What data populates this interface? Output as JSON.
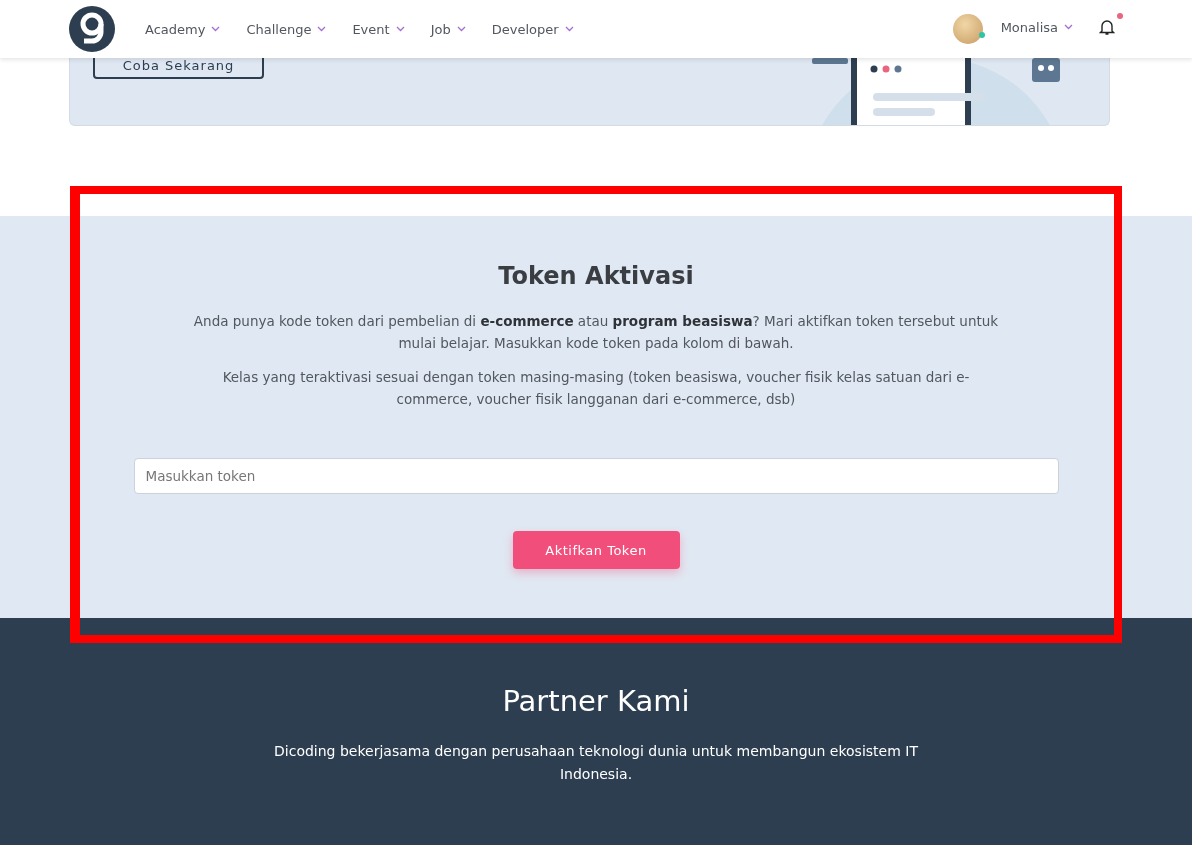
{
  "nav": {
    "items": [
      {
        "label": "Academy"
      },
      {
        "label": "Challenge"
      },
      {
        "label": "Event"
      },
      {
        "label": "Job"
      },
      {
        "label": "Developer"
      }
    ],
    "user": {
      "name": "Monalisa",
      "online": true
    },
    "notifications": {
      "unread": true
    }
  },
  "banner": {
    "button": "Coba Sekarang"
  },
  "token": {
    "title": "Token Aktivasi",
    "paragraphs": [
      "Anda punya kode token dari pembelian di **e-commerce** atau **program beasiswa**? Mari aktifkan token tersebut untuk mulai belajar. Masukkan kode token pada kolom di bawah.",
      "Kelas yang teraktivasi sesuai dengan token masing-masing (token beasiswa, voucher fisik kelas satuan dari e-commerce, voucher fisik langganan dari e-commerce, dsb)"
    ],
    "input": {
      "placeholder": "Masukkan token"
    },
    "button": "Aktifkan Token"
  },
  "partners": {
    "title": "Partner Kami",
    "text": "Dicoding bekerjasama dengan perusahaan teknologi dunia untuk membangun ekosistem IT Indonesia."
  }
}
